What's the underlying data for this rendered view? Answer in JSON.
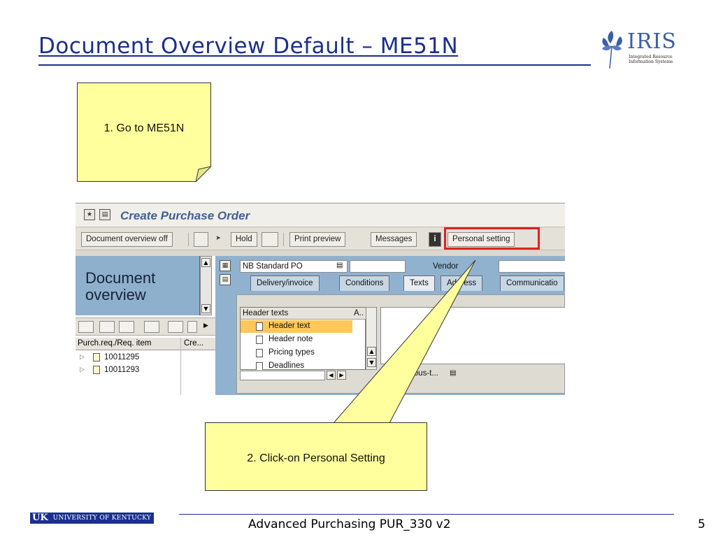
{
  "slide": {
    "title": "Document Overview Default – ME51N",
    "logo": {
      "word": "IRIS",
      "subtitle": "Integrated Resource Information Systems"
    }
  },
  "notes": {
    "step1": "1.  Go to ME51N",
    "step2": "2.  Click-on Personal Setting"
  },
  "sap": {
    "window_title": "Create Purchase Order",
    "toolbar": {
      "doc_overview_off": "Document overview off",
      "hold": "Hold",
      "print_preview": "Print preview",
      "messages": "Messages",
      "personal_setting": "Personal setting"
    },
    "left_panel": {
      "heading": "Document overview",
      "col1": "Purch.req./Req. item",
      "col2": "Cre...",
      "items": [
        "10011295",
        "10011293"
      ]
    },
    "header": {
      "doc_type": "NB Standard PO",
      "vendor_label": "Vendor"
    },
    "tabs": [
      "Delivery/invoice",
      "Conditions",
      "Texts",
      "Address",
      "Communicatio"
    ],
    "header_texts": {
      "col1": "Header texts",
      "col2": "A..",
      "items": [
        "Header text",
        "Header note",
        "Pricing types",
        "Deadlines"
      ],
      "continuous": "nuous-t..."
    }
  },
  "footer": {
    "university_short": "UK",
    "university_name": "UNIVERSITY OF KENTUCKY",
    "course": "Advanced Purchasing PUR_330 v2",
    "page": "5"
  },
  "colors": {
    "title_blue": "#1b2f8e",
    "note_yellow": "#ffff9d",
    "sap_blue": "#90b2cf",
    "highlight_red": "#e02020",
    "selection_orange": "#fdc75a"
  }
}
